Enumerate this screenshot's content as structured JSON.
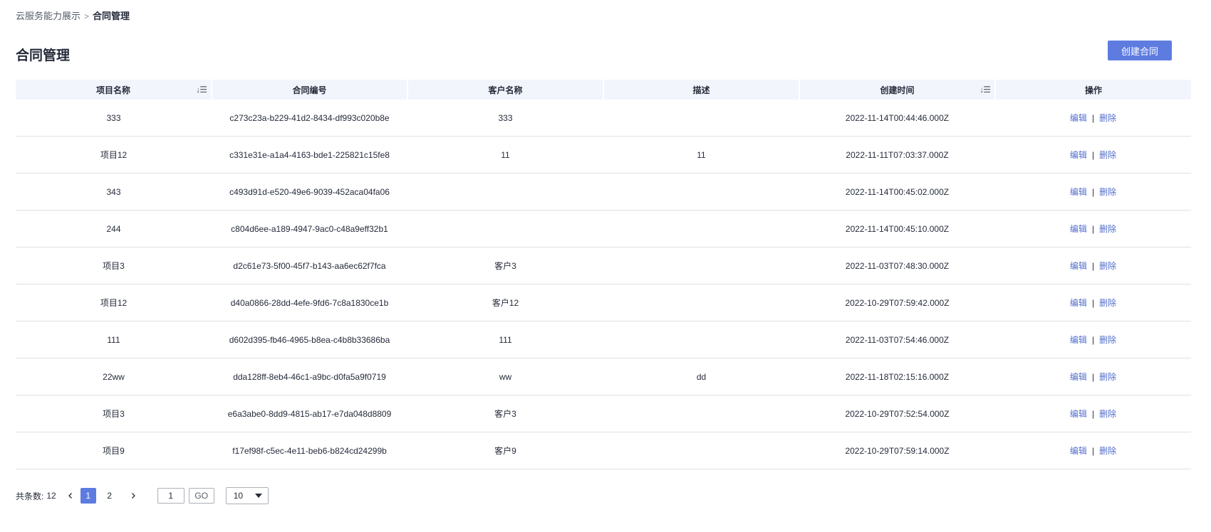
{
  "breadcrumb": {
    "parent": "云服务能力展示",
    "separator": ">",
    "current": "合同管理"
  },
  "page": {
    "title": "合同管理",
    "create_button": "创建合同"
  },
  "table": {
    "columns": {
      "project_name": "项目名称",
      "contract_id": "合同编号",
      "customer_name": "客户名称",
      "description": "描述",
      "created_at": "创建时间",
      "actions": "操作"
    },
    "sort_icon": "sort-icon",
    "rows": [
      {
        "project_name": "333",
        "contract_id": "c273c23a-b229-41d2-8434-df993c020b8e",
        "customer_name": "333",
        "description": "",
        "created_at": "2022-11-14T00:44:46.000Z"
      },
      {
        "project_name": "项目12",
        "contract_id": "c331e31e-a1a4-4163-bde1-225821c15fe8",
        "customer_name": "11",
        "description": "11",
        "created_at": "2022-11-11T07:03:37.000Z"
      },
      {
        "project_name": "343",
        "contract_id": "c493d91d-e520-49e6-9039-452aca04fa06",
        "customer_name": "",
        "description": "",
        "created_at": "2022-11-14T00:45:02.000Z"
      },
      {
        "project_name": "244",
        "contract_id": "c804d6ee-a189-4947-9ac0-c48a9eff32b1",
        "customer_name": "",
        "description": "",
        "created_at": "2022-11-14T00:45:10.000Z"
      },
      {
        "project_name": "项目3",
        "contract_id": "d2c61e73-5f00-45f7-b143-aa6ec62f7fca",
        "customer_name": "客户3",
        "description": "",
        "created_at": "2022-11-03T07:48:30.000Z"
      },
      {
        "project_name": "项目12",
        "contract_id": "d40a0866-28dd-4efe-9fd6-7c8a1830ce1b",
        "customer_name": "客户12",
        "description": "",
        "created_at": "2022-10-29T07:59:42.000Z"
      },
      {
        "project_name": "111",
        "contract_id": "d602d395-fb46-4965-b8ea-c4b8b33686ba",
        "customer_name": "111",
        "description": "",
        "created_at": "2022-11-03T07:54:46.000Z"
      },
      {
        "project_name": "22ww",
        "contract_id": "dda128ff-8eb4-46c1-a9bc-d0fa5a9f0719",
        "customer_name": "ww",
        "description": "dd",
        "created_at": "2022-11-18T02:15:16.000Z"
      },
      {
        "project_name": "项目3",
        "contract_id": "e6a3abe0-8dd9-4815-ab17-e7da048d8809",
        "customer_name": "客户3",
        "description": "",
        "created_at": "2022-10-29T07:52:54.000Z"
      },
      {
        "project_name": "项目9",
        "contract_id": "f17ef98f-c5ec-4e11-beb6-b824cd24299b",
        "customer_name": "客户9",
        "description": "",
        "created_at": "2022-10-29T07:59:14.000Z"
      }
    ],
    "actions": {
      "edit": "编辑",
      "divider": "|",
      "delete": "删除"
    }
  },
  "pagination": {
    "total_label": "共条数:",
    "total": "12",
    "prev_icon": "chevron-left-icon",
    "next_icon": "chevron-right-icon",
    "pages": [
      "1",
      "2"
    ],
    "current_page": "1",
    "jump_value": "1",
    "go_label": "GO",
    "page_size": "10"
  },
  "colors": {
    "accent": "#5e7ce0",
    "link": "#526ecc",
    "header_bg": "#f2f5fc",
    "border": "#dfe1e6"
  }
}
